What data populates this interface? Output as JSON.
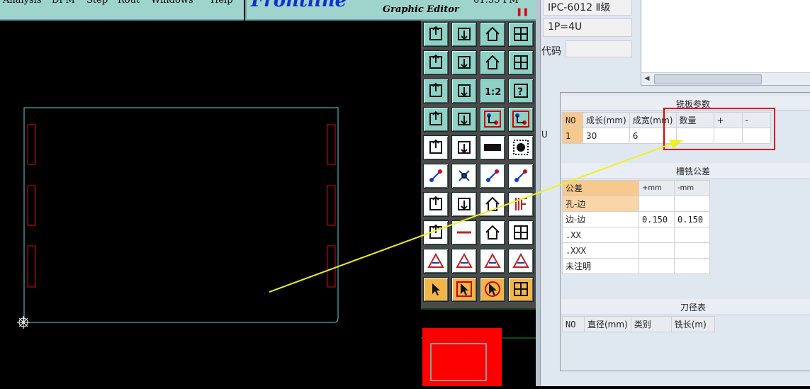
{
  "menu": {
    "analysis": "Analysis",
    "dfm": "DFM",
    "step": "Step",
    "rout": "Rout",
    "windows": "Windows",
    "help": "Help"
  },
  "app": {
    "brand": "Frontline",
    "subtitle": "Graphic Editor",
    "clock": "01:55 PM",
    "pause_glyph": "❚❚"
  },
  "toolbar": {
    "rows": [
      [
        "home-icon",
        "zoom-in-icon",
        "house-icon",
        "frame-icon"
      ],
      [
        "move-left-icon",
        "move-right-icon",
        "mirror-icon",
        "s-step-icon"
      ],
      [
        "fit-icon",
        "center-icon",
        "scale-1-2-icon",
        "help-icon"
      ],
      [
        "tools-icon",
        "probe-icon",
        "netlist-icon",
        "netlist-compare-icon"
      ],
      [
        "select-pad-icon",
        "select-rect-icon",
        "ruler-icon",
        "circle-icon"
      ],
      [
        "connect-icon",
        "snap-x-icon",
        "measure-point-icon",
        "measure-pair-icon"
      ],
      [
        "angle-icon",
        "line-measure-icon",
        "arc-icon",
        "edge-icon"
      ],
      [
        "corner-icon",
        "line-icon",
        "dimension-icon",
        "flip-icon"
      ],
      [
        "triangle-icon",
        "delta-icon",
        "a-up-icon",
        "a-down-icon"
      ],
      [
        "cursor-icon",
        "cursor-box-icon",
        "cursor-rotate-icon",
        "step-path-icon"
      ]
    ]
  },
  "panel": {
    "model": "IPC-6012 Ⅱ级",
    "panel_setting": "1P=4U",
    "code_label": "代码",
    "code_value": "",
    "u_label": "U",
    "mill_title": "铣板参数",
    "mill_headers": [
      "NO",
      "成长(mm)",
      "成宽(mm)",
      "数量",
      "+",
      "-"
    ],
    "mill_rows": [
      [
        "1",
        "30",
        "6",
        "",
        "",
        ""
      ]
    ],
    "tol_title": "槽铣公差",
    "tol_headers": [
      "公差",
      "+mm",
      "-mm"
    ],
    "tol_rows": [
      [
        "孔-边",
        "",
        ""
      ],
      [
        "边-边",
        "0.150",
        "0.150"
      ],
      [
        ".XX",
        "",
        ""
      ],
      [
        ".XXX",
        "",
        ""
      ],
      [
        "未注明",
        "",
        ""
      ]
    ],
    "tool_title": "刀径表",
    "tool_headers": [
      "NO",
      "直径(mm)",
      "类别",
      "铣长(m)"
    ]
  },
  "colors": {
    "canvas_bg": "#000000",
    "board_outline": "#5fd0d8",
    "slot_outline": "#c00000",
    "arrow": "#f0f020",
    "highlight_box": "#e00000",
    "toolbar_btn": "#8ed2c6",
    "header_orange": "#f7c98e",
    "panel_bg": "#dfe7f1"
  }
}
